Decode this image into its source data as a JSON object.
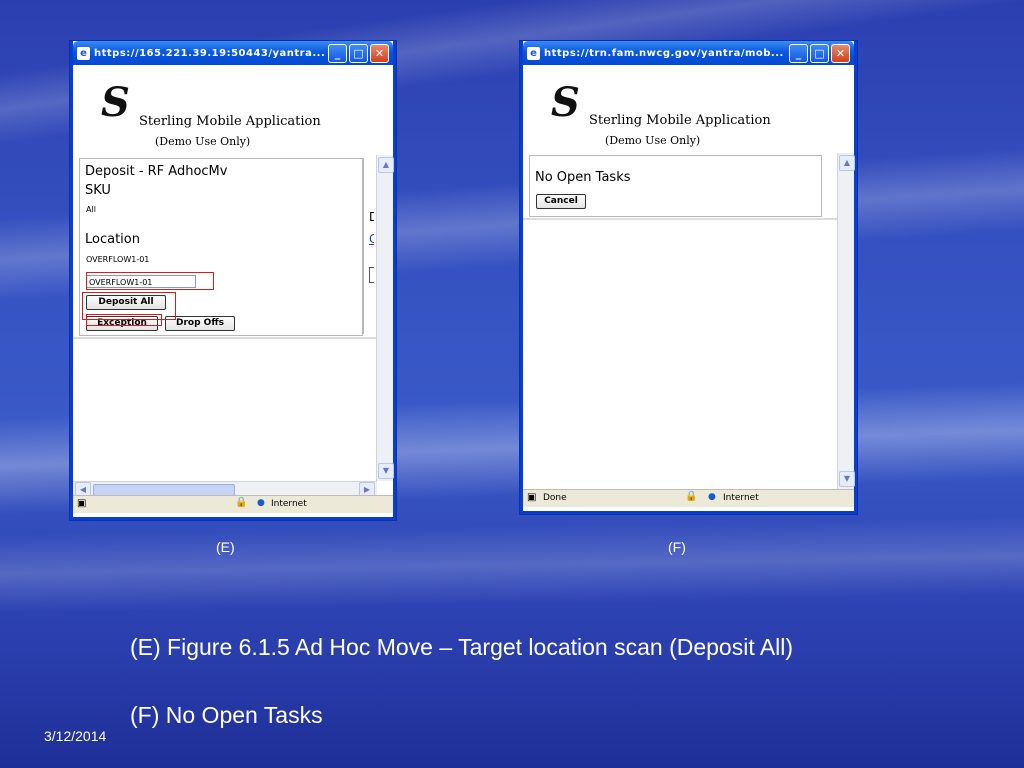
{
  "window_e": {
    "title": "https://165.221.39.19:50443/yantra...",
    "app_title": "Sterling Mobile Application",
    "demo_note": "(Demo Use Only)",
    "deposit_heading": "Deposit -  RF AdhocMv",
    "sku_label": "SKU",
    "sku_value": "All",
    "location_label": "Location",
    "location_value": "OVERFLOW1-01",
    "location_input": "OVERFLOW1-01",
    "deposit_all_button": "Deposit All",
    "exception_button": "Exception",
    "drop_offs_button": "Drop Offs",
    "side_char_1": "D",
    "side_char_2": "C",
    "status_zone": "Internet"
  },
  "window_f": {
    "title": "https://trn.fam.nwcg.gov/yantra/mob...",
    "app_title": "Sterling Mobile Application",
    "demo_note": "(Demo Use Only)",
    "message": "No Open Tasks",
    "cancel_button": "Cancel",
    "status_text": "Done",
    "status_zone": "Internet"
  },
  "captions": {
    "label_e": "(E)",
    "label_f": "(F)",
    "line1": "(E) Figure 6.1.5 Ad Hoc Move – Target location scan (Deposit All)",
    "line2": "(F) No Open Tasks"
  },
  "footer": {
    "date": "3/12/2014"
  },
  "colors": {
    "highlight": "#e01818",
    "titlebar": "#0a5ae0",
    "link": "#1a3ad0"
  }
}
